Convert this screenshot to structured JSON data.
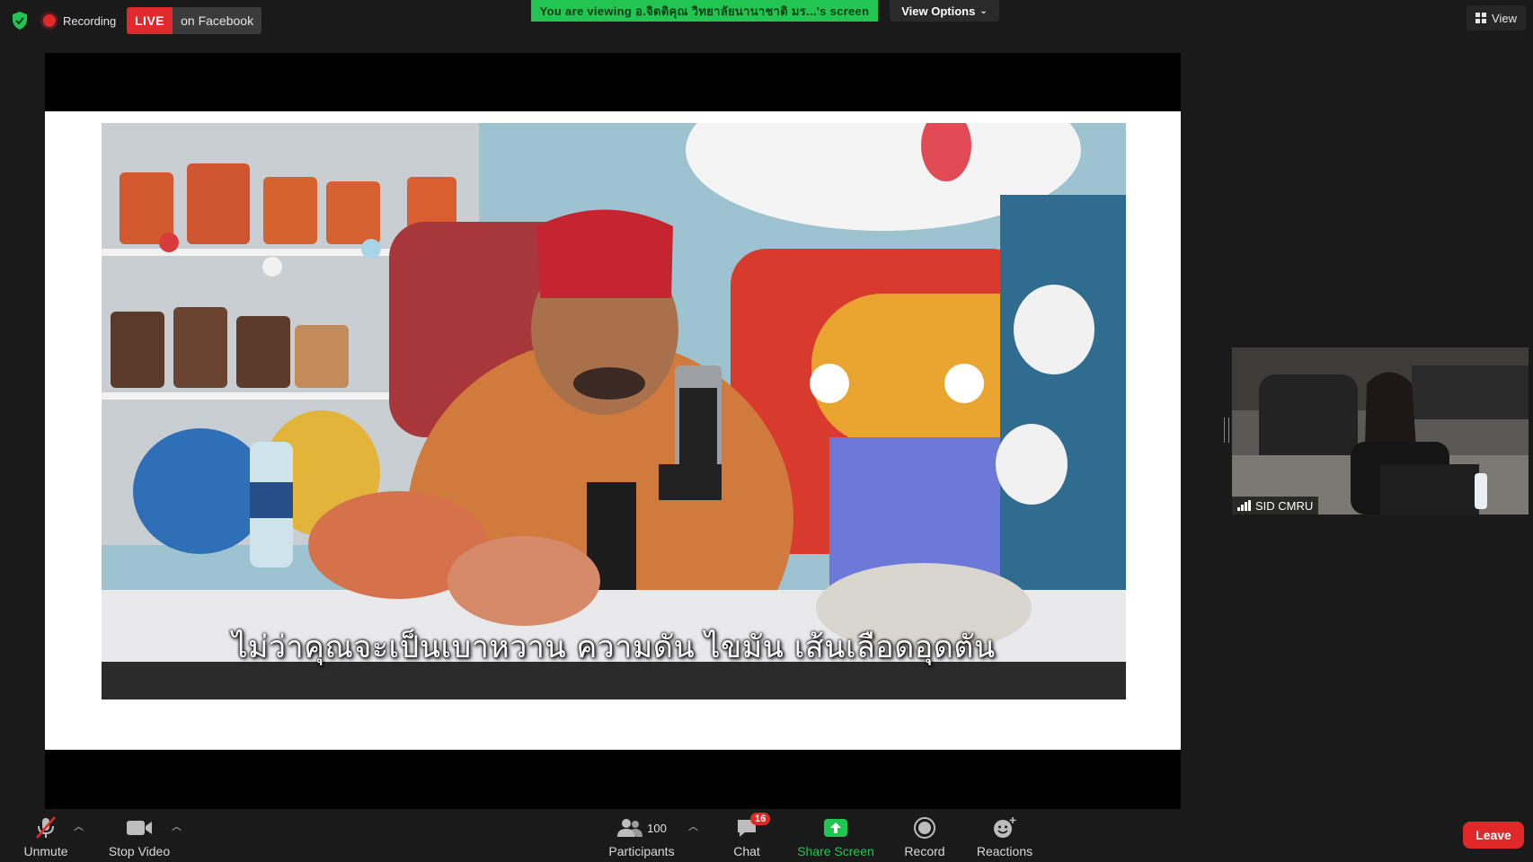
{
  "top_bar": {
    "recording_label": "Recording",
    "live_badge": "LIVE",
    "live_destination": "on Facebook",
    "viewing_banner": "You are viewing อ.จิตติคุณ วิทยาลัยนานาชาติ มร...'s screen",
    "view_options_label": "View Options",
    "view_label": "View"
  },
  "shared_screen": {
    "subtitle": "ไม่ว่าคุณจะเป็นเบาหวาน ความดัน ไขมัน เส้นเลือดอุดตัน"
  },
  "participant": {
    "name": "SID CMRU"
  },
  "toolbar": {
    "unmute_label": "Unmute",
    "stop_video_label": "Stop Video",
    "participants_label": "Participants",
    "participants_count": "100",
    "chat_label": "Chat",
    "chat_badge": "16",
    "share_screen_label": "Share Screen",
    "record_label": "Record",
    "reactions_label": "Reactions",
    "leave_label": "Leave"
  },
  "colors": {
    "accent_green": "#23c552",
    "danger_red": "#e02828",
    "background": "#1a1a1a"
  },
  "icons": [
    "shield-icon",
    "recording-dot-icon",
    "chevron-down-icon",
    "grid-view-icon",
    "signal-icon",
    "mic-muted-icon",
    "video-camera-icon",
    "participants-icon",
    "chat-icon",
    "share-screen-icon",
    "record-icon",
    "reactions-icon"
  ]
}
